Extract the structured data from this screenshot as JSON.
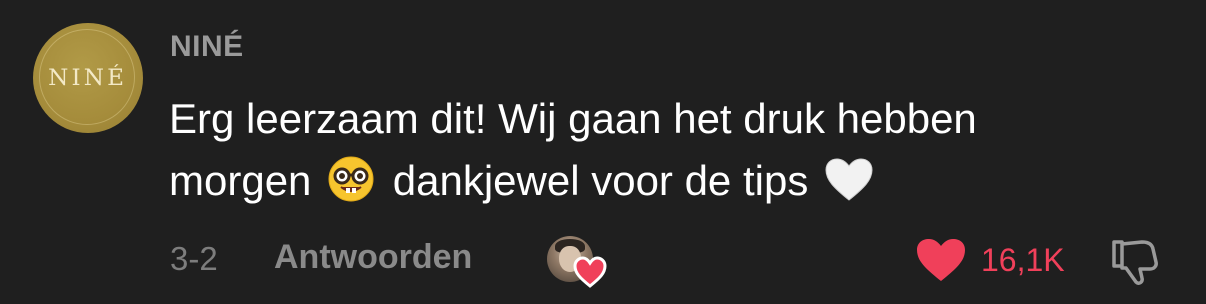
{
  "comment": {
    "avatar_text": "NINÉ",
    "username": "NINÉ",
    "text_line1": "Erg leerzaam dit! Wij gaan het druk hebben",
    "text_line2_before": "morgen",
    "text_line2_middle": "dankjewel voor de tips",
    "emoji_1": "nerd-face",
    "emoji_2": "white-heart",
    "date": "3-2",
    "reply_label": "Antwoorden",
    "like_count": "16,1K"
  },
  "colors": {
    "background": "#1f1f1f",
    "avatar_gold": "#a58c3b",
    "like_red": "#f0405a",
    "muted_text": "#8a8a8a"
  }
}
